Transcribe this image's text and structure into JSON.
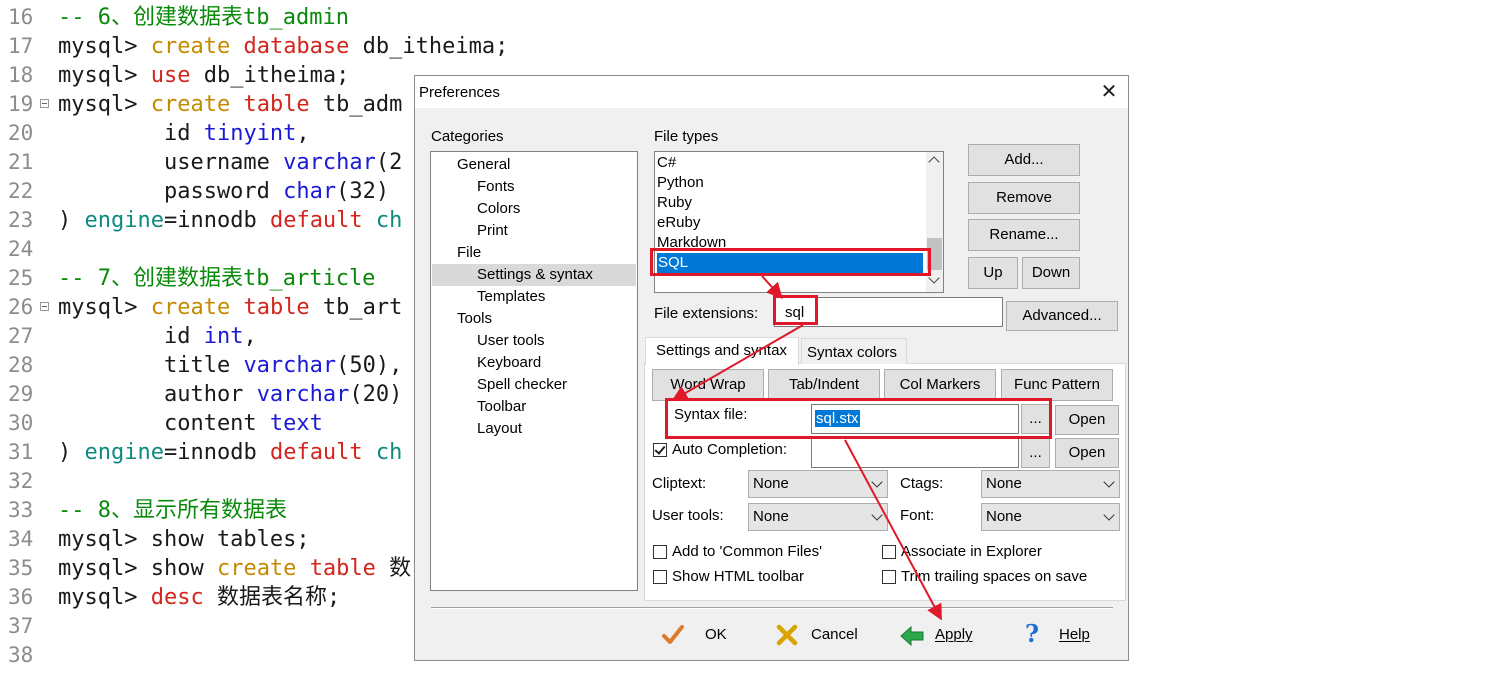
{
  "editor": {
    "lines": [
      {
        "num": "16",
        "fold": false,
        "tokens": [
          {
            "t": "-- 6、创建数据表tb_admin",
            "c": "comment"
          }
        ]
      },
      {
        "num": "17",
        "fold": false,
        "tokens": [
          {
            "t": "mysql> ",
            "c": "plain"
          },
          {
            "t": "create",
            "c": "func"
          },
          {
            "t": " ",
            "c": "plain"
          },
          {
            "t": "database",
            "c": "keyword"
          },
          {
            "t": " db_itheima;",
            "c": "plain"
          }
        ]
      },
      {
        "num": "18",
        "fold": false,
        "tokens": [
          {
            "t": "mysql> ",
            "c": "plain"
          },
          {
            "t": "use",
            "c": "keyword"
          },
          {
            "t": " db_itheima;",
            "c": "plain"
          }
        ]
      },
      {
        "num": "19",
        "fold": true,
        "tokens": [
          {
            "t": "mysql> ",
            "c": "plain"
          },
          {
            "t": "create",
            "c": "func"
          },
          {
            "t": " ",
            "c": "plain"
          },
          {
            "t": "table",
            "c": "keyword"
          },
          {
            "t": " tb_adm",
            "c": "plain"
          }
        ]
      },
      {
        "num": "20",
        "fold": false,
        "tokens": [
          {
            "t": "        id ",
            "c": "plain"
          },
          {
            "t": "tinyint",
            "c": "type"
          },
          {
            "t": ",",
            "c": "plain"
          }
        ]
      },
      {
        "num": "21",
        "fold": false,
        "tokens": [
          {
            "t": "        username ",
            "c": "plain"
          },
          {
            "t": "varchar",
            "c": "type"
          },
          {
            "t": "(2",
            "c": "plain"
          }
        ]
      },
      {
        "num": "22",
        "fold": false,
        "tokens": [
          {
            "t": "        password ",
            "c": "plain"
          },
          {
            "t": "char",
            "c": "type"
          },
          {
            "t": "(32)",
            "c": "plain"
          }
        ]
      },
      {
        "num": "23",
        "fold": false,
        "tokens": [
          {
            "t": ") ",
            "c": "plain"
          },
          {
            "t": "engine",
            "c": "teal"
          },
          {
            "t": "=innodb ",
            "c": "plain"
          },
          {
            "t": "default",
            "c": "keyword"
          },
          {
            "t": " ",
            "c": "plain"
          },
          {
            "t": "ch",
            "c": "teal"
          }
        ]
      },
      {
        "num": "24",
        "fold": false,
        "tokens": []
      },
      {
        "num": "25",
        "fold": false,
        "tokens": [
          {
            "t": "-- 7、创建数据表tb_article",
            "c": "comment"
          }
        ]
      },
      {
        "num": "26",
        "fold": true,
        "tokens": [
          {
            "t": "mysql> ",
            "c": "plain"
          },
          {
            "t": "create",
            "c": "func"
          },
          {
            "t": " ",
            "c": "plain"
          },
          {
            "t": "table",
            "c": "keyword"
          },
          {
            "t": " tb_art",
            "c": "plain"
          }
        ]
      },
      {
        "num": "27",
        "fold": false,
        "tokens": [
          {
            "t": "        id ",
            "c": "plain"
          },
          {
            "t": "int",
            "c": "type"
          },
          {
            "t": ",",
            "c": "plain"
          }
        ]
      },
      {
        "num": "28",
        "fold": false,
        "tokens": [
          {
            "t": "        title ",
            "c": "plain"
          },
          {
            "t": "varchar",
            "c": "type"
          },
          {
            "t": "(50),",
            "c": "plain"
          }
        ]
      },
      {
        "num": "29",
        "fold": false,
        "tokens": [
          {
            "t": "        author ",
            "c": "plain"
          },
          {
            "t": "varchar",
            "c": "type"
          },
          {
            "t": "(20)",
            "c": "plain"
          }
        ]
      },
      {
        "num": "30",
        "fold": false,
        "tokens": [
          {
            "t": "        content ",
            "c": "plain"
          },
          {
            "t": "text",
            "c": "type"
          }
        ]
      },
      {
        "num": "31",
        "fold": false,
        "tokens": [
          {
            "t": ") ",
            "c": "plain"
          },
          {
            "t": "engine",
            "c": "teal"
          },
          {
            "t": "=innodb ",
            "c": "plain"
          },
          {
            "t": "default",
            "c": "keyword"
          },
          {
            "t": " ",
            "c": "plain"
          },
          {
            "t": "ch",
            "c": "teal"
          }
        ]
      },
      {
        "num": "32",
        "fold": false,
        "tokens": []
      },
      {
        "num": "33",
        "fold": false,
        "tokens": [
          {
            "t": "-- 8、显示所有数据表",
            "c": "comment"
          }
        ]
      },
      {
        "num": "34",
        "fold": false,
        "tokens": [
          {
            "t": "mysql> show tables;",
            "c": "plain"
          }
        ]
      },
      {
        "num": "35",
        "fold": false,
        "tokens": [
          {
            "t": "mysql> show ",
            "c": "plain"
          },
          {
            "t": "create",
            "c": "func"
          },
          {
            "t": " ",
            "c": "plain"
          },
          {
            "t": "table",
            "c": "keyword"
          },
          {
            "t": " 数",
            "c": "plain"
          }
        ]
      },
      {
        "num": "36",
        "fold": false,
        "tokens": [
          {
            "t": "mysql> ",
            "c": "plain"
          },
          {
            "t": "desc",
            "c": "keyword"
          },
          {
            "t": " 数据表名称;",
            "c": "plain"
          }
        ]
      },
      {
        "num": "37",
        "fold": false,
        "tokens": []
      },
      {
        "num": "38",
        "fold": false,
        "tokens": []
      }
    ]
  },
  "dialog": {
    "title": "Preferences",
    "close_glyph": "✕",
    "categories": {
      "label": "Categories",
      "items": [
        {
          "label": "General",
          "level": 0,
          "selected": false
        },
        {
          "label": "Fonts",
          "level": 1,
          "selected": false
        },
        {
          "label": "Colors",
          "level": 1,
          "selected": false
        },
        {
          "label": "Print",
          "level": 1,
          "selected": false
        },
        {
          "label": "File",
          "level": 0,
          "selected": false
        },
        {
          "label": "Settings & syntax",
          "level": 1,
          "selected": true
        },
        {
          "label": "Templates",
          "level": 1,
          "selected": false
        },
        {
          "label": "Tools",
          "level": 0,
          "selected": false
        },
        {
          "label": "User tools",
          "level": 1,
          "selected": false
        },
        {
          "label": "Keyboard",
          "level": 1,
          "selected": false
        },
        {
          "label": "Spell checker",
          "level": 1,
          "selected": false
        },
        {
          "label": "Toolbar",
          "level": 1,
          "selected": false
        },
        {
          "label": "Layout",
          "level": 1,
          "selected": false
        }
      ]
    },
    "file_types": {
      "label": "File types",
      "items": [
        "C#",
        "Python",
        "Ruby",
        "eRuby",
        "Markdown",
        "SQL"
      ],
      "selected": "SQL"
    },
    "side_buttons": {
      "add": "Add...",
      "remove": "Remove",
      "rename": "Rename...",
      "up": "Up",
      "down": "Down"
    },
    "extensions": {
      "label": "File extensions:",
      "value": "sql",
      "advanced": "Advanced..."
    },
    "tabs": [
      "Settings and syntax",
      "Syntax colors"
    ],
    "sub_buttons": [
      "Word Wrap",
      "Tab/Indent",
      "Col Markers",
      "Func Pattern"
    ],
    "syntax_file": {
      "label": "Syntax file:",
      "value": "sql.stx",
      "browse": "...",
      "open": "Open"
    },
    "auto_completion": {
      "label": "Auto Completion:",
      "checked": true,
      "value": "",
      "browse": "...",
      "open": "Open"
    },
    "cliptext": {
      "label": "Cliptext:",
      "value": "None"
    },
    "ctags": {
      "label": "Ctags:",
      "value": "None"
    },
    "user_tools": {
      "label": "User tools:",
      "value": "None"
    },
    "font": {
      "label": "Font:",
      "value": "None"
    },
    "checkboxes": {
      "common_files": {
        "label": "Add to 'Common Files'",
        "checked": false
      },
      "associate": {
        "label": "Associate in Explorer",
        "checked": false
      },
      "html_toolbar": {
        "label": "Show HTML toolbar",
        "checked": false
      },
      "trim": {
        "label": "Trim trailing spaces on save",
        "checked": false
      }
    },
    "footer": {
      "ok": "OK",
      "cancel": "Cancel",
      "apply": "Apply",
      "help": "Help"
    }
  },
  "colors": {
    "annotation_red": "#e0192a",
    "selection_blue": "#0078d7",
    "ok_orange": "#e07b2a",
    "cancel_yellow": "#d9a400",
    "apply_green": "#2aa84a",
    "help_blue": "#1e6fd9"
  }
}
